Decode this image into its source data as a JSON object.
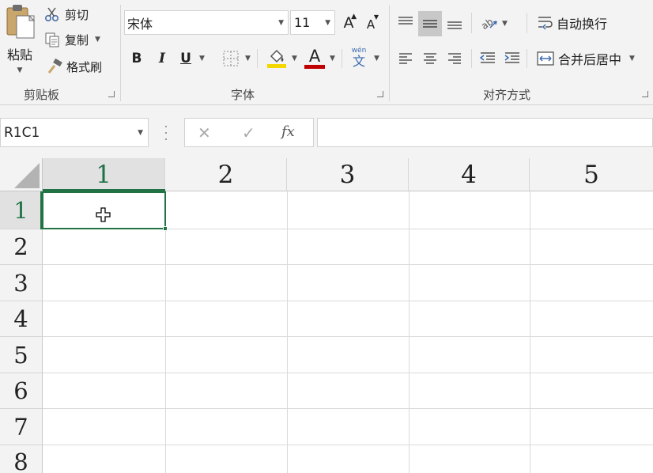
{
  "clipboard": {
    "paste_label": "粘贴",
    "cut_label": "剪切",
    "copy_label": "复制",
    "format_painter_label": "格式刷",
    "group_label": "剪贴板"
  },
  "font": {
    "font_name": "宋体",
    "font_size": "11",
    "bold": "B",
    "italic": "I",
    "underline": "U",
    "group_label": "字体",
    "phonetic_top": "wén",
    "phonetic_char": "文",
    "font_color_glyph": "A",
    "grow_glyph": "A",
    "shrink_glyph": "A",
    "highlight_color": "#f4d600",
    "font_color": "#c00000"
  },
  "alignment": {
    "wrap_text_label": "自动换行",
    "merge_center_label": "合并后居中",
    "group_label": "对齐方式"
  },
  "formula_bar": {
    "name_box": "R1C1",
    "cancel": "✕",
    "enter": "✓",
    "fx": "fx",
    "value": ""
  },
  "sheet": {
    "columns": [
      "1",
      "2",
      "3",
      "4",
      "5"
    ],
    "rows": [
      "1",
      "2",
      "3",
      "4",
      "5",
      "6",
      "7",
      "8"
    ],
    "accent": "#217346"
  }
}
